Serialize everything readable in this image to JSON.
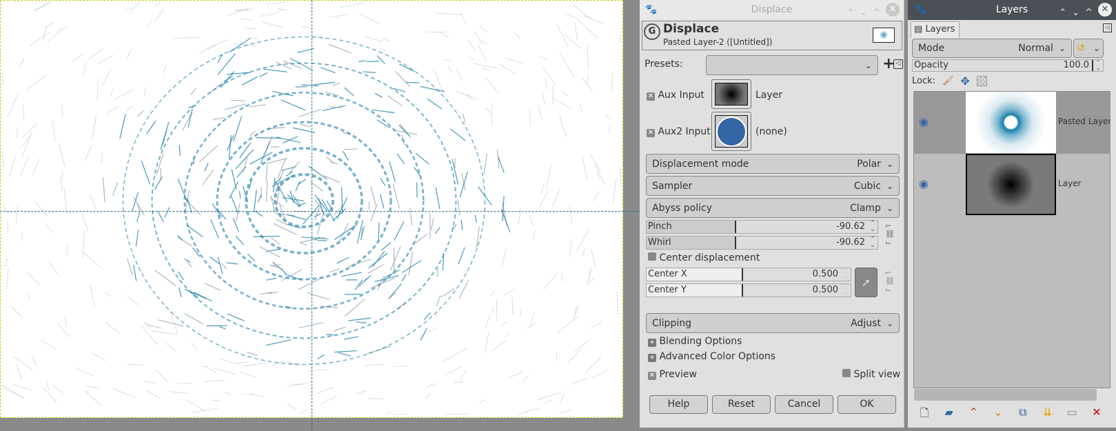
{
  "displace": {
    "window_title": "Displace",
    "heading": "Displace",
    "subtitle": "Pasted Layer-2 ([Untitled])",
    "presets_label": "Presets:",
    "presets_value": "",
    "aux_input_label": "Aux Input",
    "aux_input_value": "Layer",
    "aux2_input_label": "Aux2 Input",
    "aux2_input_value": "(none)",
    "displacement_mode": {
      "label": "Displacement mode",
      "value": "Polar"
    },
    "sampler": {
      "label": "Sampler",
      "value": "Cubic"
    },
    "abyss_policy": {
      "label": "Abyss policy",
      "value": "Clamp"
    },
    "pinch": {
      "label": "Pinch",
      "value": "-90.62"
    },
    "whirl": {
      "label": "Whirl",
      "value": "-90.62"
    },
    "center_displacement_label": "Center displacement",
    "center_x": {
      "label": "Center X",
      "value": "0.500"
    },
    "center_y": {
      "label": "Center Y",
      "value": "0.500"
    },
    "clipping": {
      "label": "Clipping",
      "value": "Adjust"
    },
    "blending_options": "Blending Options",
    "advanced_color_options": "Advanced Color Options",
    "preview_label": "Preview",
    "split_view_label": "Split view",
    "buttons": {
      "help": "Help",
      "reset": "Reset",
      "cancel": "Cancel",
      "ok": "OK"
    }
  },
  "layers": {
    "window_title": "Layers",
    "tab_label": "Layers",
    "mode_label": "Mode",
    "mode_value": "Normal",
    "opacity_label": "Opacity",
    "opacity_value": "100.0",
    "lock_label": "Lock:",
    "items": [
      {
        "name": "Pasted Layer"
      },
      {
        "name": "Layer"
      }
    ]
  },
  "colors": {
    "accent_blue": "#3465a4",
    "teal": "#1a7fa8",
    "close_red": "#cc0000"
  }
}
